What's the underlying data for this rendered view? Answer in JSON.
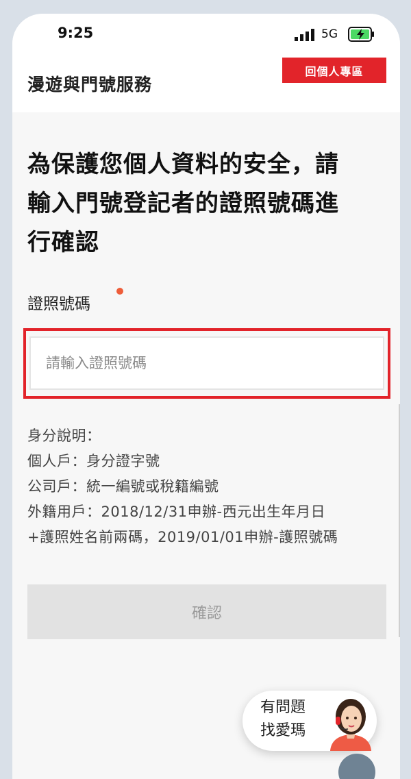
{
  "status_bar": {
    "time": "9:25",
    "network": "5G"
  },
  "header": {
    "title": "漫遊與門號服務",
    "back_button": "回個人專區"
  },
  "heading_lines": [
    "為保護您個人資料的安全，請",
    "輸入門號登記者的證照號碼進",
    "行確認"
  ],
  "form": {
    "label": "證照號碼",
    "placeholder": "請輸入證照號碼",
    "value": ""
  },
  "id_info": [
    "身分說明：",
    "個人戶：身分證字號",
    "公司戶：統一編號或稅籍編號",
    "外籍用戶：2018/12/31申辦-西元出生年月日",
    "+護照姓名前兩碼，2019/01/01申辦-護照號碼"
  ],
  "confirm_button": "確認",
  "help": {
    "line1": "有問題",
    "line2": "找愛瑪"
  },
  "colors": {
    "accent_red": "#e2242a",
    "required_dot": "#ee5d3a",
    "disabled_button": "#e2e2e2"
  }
}
